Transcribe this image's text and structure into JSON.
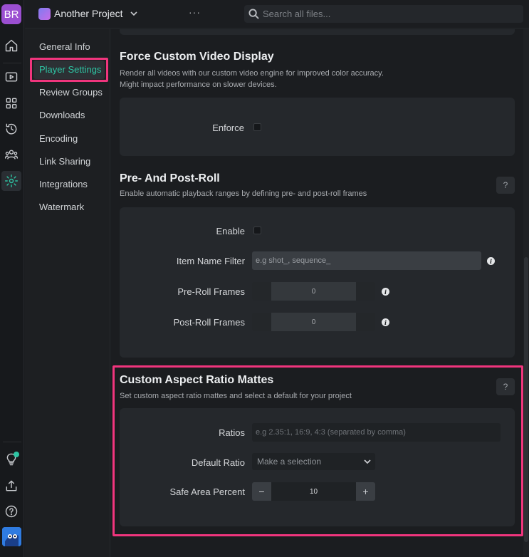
{
  "rail": {
    "avatar_initials": "BR",
    "icons": [
      "home-icon",
      "play-icon",
      "grid-icon",
      "history-icon",
      "users-icon",
      "gear-icon",
      "lightbulb-icon",
      "upload-icon",
      "help-icon"
    ]
  },
  "topbar": {
    "project_name": "Another Project",
    "more_label": "···",
    "search_placeholder": "Search all files..."
  },
  "nav": {
    "items": [
      {
        "label": "General Info",
        "active": false
      },
      {
        "label": "Player Settings",
        "active": true
      },
      {
        "label": "Review Groups",
        "active": false
      },
      {
        "label": "Downloads",
        "active": false
      },
      {
        "label": "Encoding",
        "active": false
      },
      {
        "label": "Link Sharing",
        "active": false
      },
      {
        "label": "Integrations",
        "active": false
      },
      {
        "label": "Watermark",
        "active": false
      }
    ]
  },
  "force_video": {
    "title": "Force Custom Video Display",
    "desc_line1": "Render all videos with our custom video engine for improved color accuracy.",
    "desc_line2": "Might impact performance on slower devices.",
    "enforce_label": "Enforce",
    "enforce_checked": false
  },
  "preroll": {
    "title": "Pre- And Post-Roll",
    "desc": "Enable automatic playback ranges by defining pre- and post-roll frames",
    "help": "?",
    "enable_label": "Enable",
    "enable_checked": false,
    "filter_label": "Item Name Filter",
    "filter_placeholder": "e.g shot_, sequence_",
    "pre_label": "Pre-Roll Frames",
    "pre_value": "0",
    "post_label": "Post-Roll Frames",
    "post_value": "0",
    "info_glyph": "i"
  },
  "mattes": {
    "title": "Custom Aspect Ratio Mattes",
    "desc": "Set custom aspect ratio mattes and select a default for your project",
    "help": "?",
    "ratios_label": "Ratios",
    "ratios_placeholder": "e.g 2.35:1, 16:9, 4:3 (separated by comma)",
    "default_label": "Default Ratio",
    "default_value": "Make a selection",
    "safe_label": "Safe Area Percent",
    "safe_value": "10",
    "minus": "−",
    "plus": "+"
  },
  "colors": {
    "accent": "#2ec5a4",
    "highlight": "#f0357d"
  }
}
